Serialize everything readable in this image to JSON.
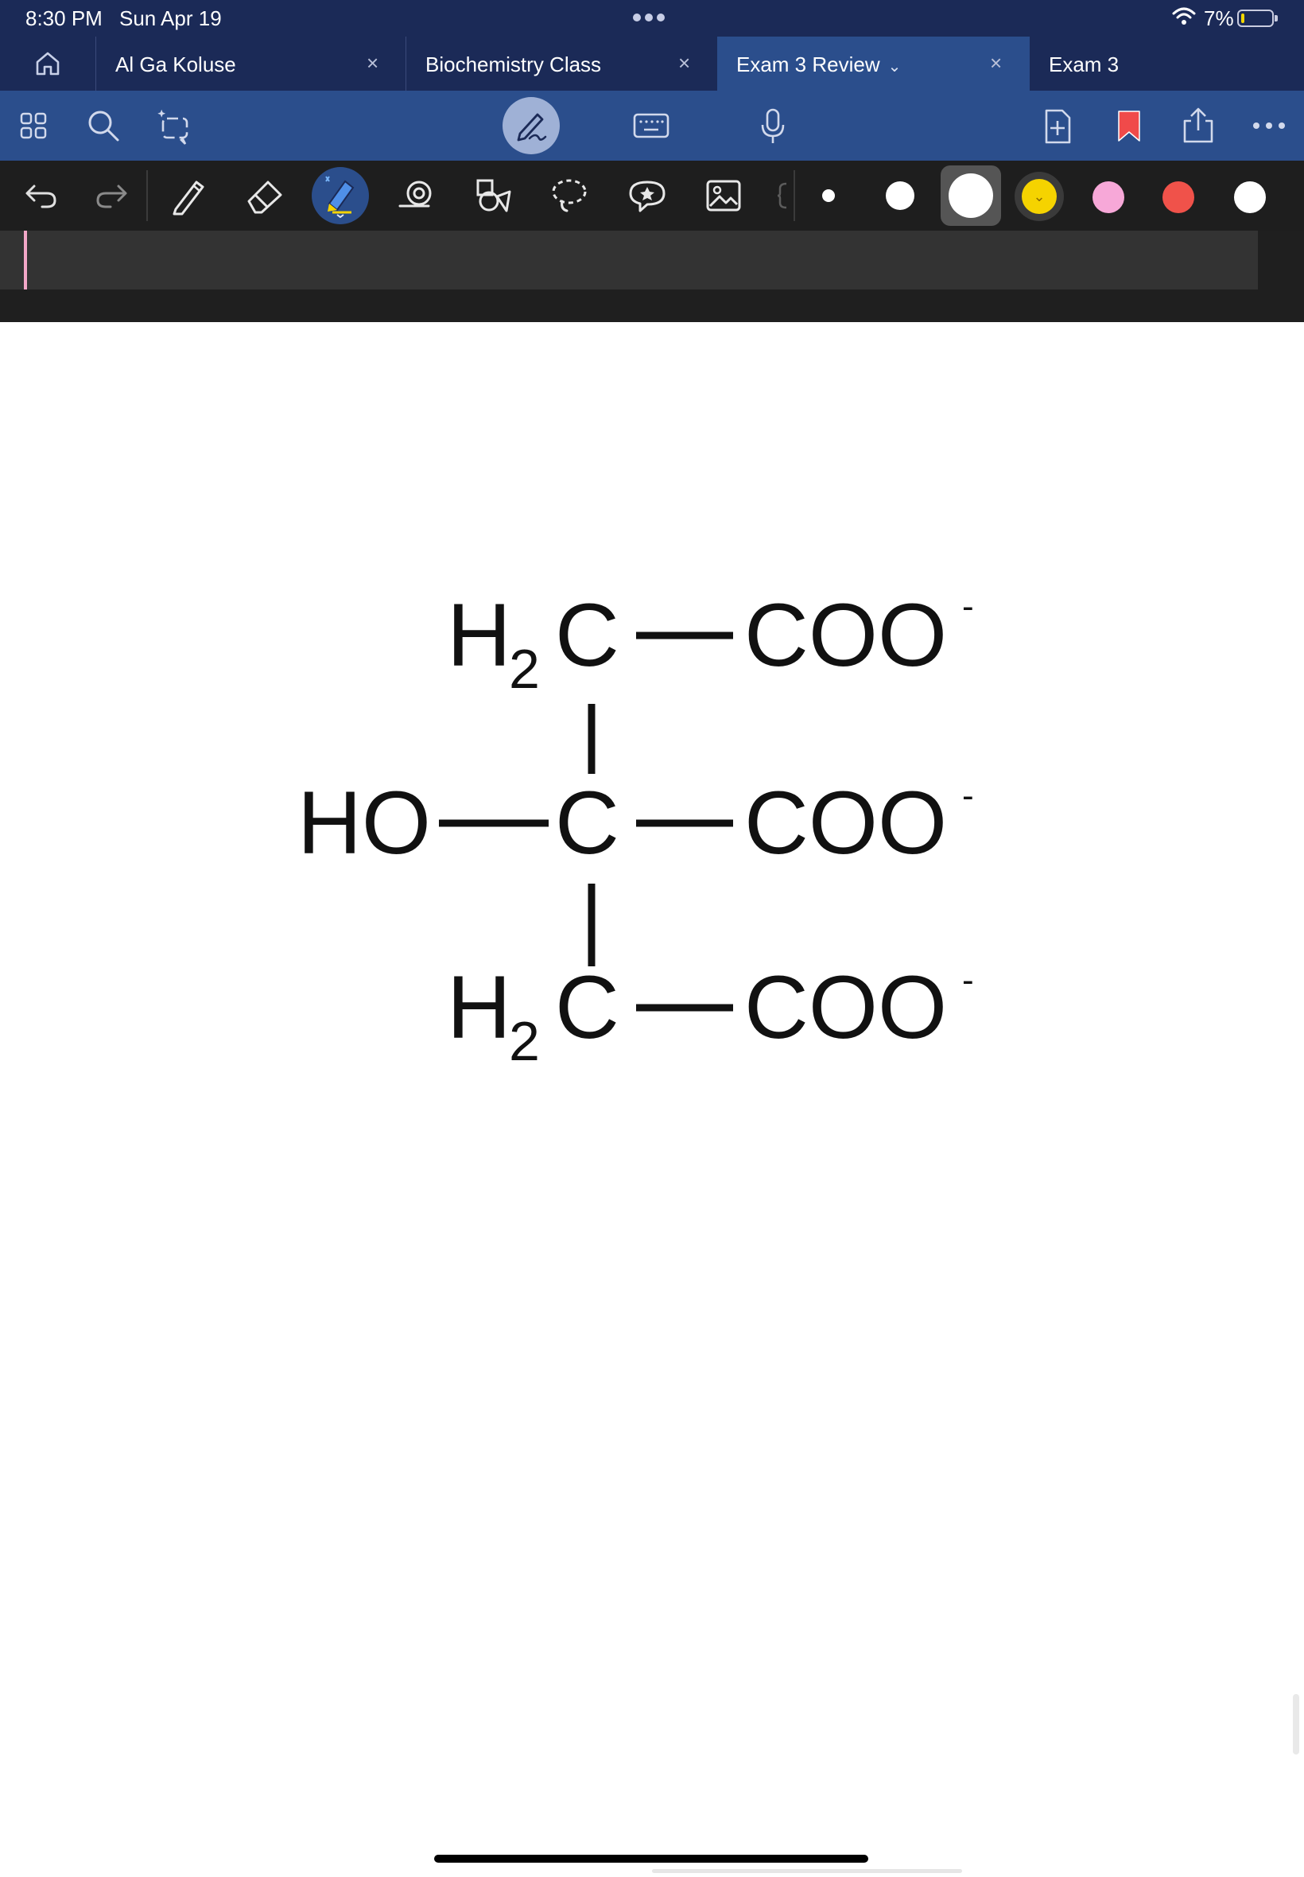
{
  "status_bar": {
    "time": "8:30 PM",
    "date": "Sun Apr 19",
    "battery_percent": "7%",
    "battery_level": 0.07
  },
  "tabs": [
    {
      "label": "Al Ga Koluse",
      "closable": true,
      "active": false
    },
    {
      "label": "Biochemistry Class",
      "closable": true,
      "active": false
    },
    {
      "label": "Exam 3 Review",
      "closable": true,
      "active": true,
      "dropdown": true
    },
    {
      "label": "Exam 3",
      "closable": false,
      "active": false
    }
  ],
  "toolbar_icons": [
    "grid-icon",
    "search-icon",
    "magic-select-icon",
    "pen-handwriting-icon",
    "keyboard-icon",
    "microphone-icon",
    "add-page-icon",
    "bookmark-icon",
    "share-icon",
    "more-icon"
  ],
  "drawing_tools": [
    "undo-icon",
    "redo-icon",
    "pen-icon",
    "eraser-icon",
    "highlighter-icon",
    "zoom-lasso-icon",
    "shapes-icon",
    "lasso-icon",
    "sticker-icon",
    "image-icon"
  ],
  "palette": {
    "sizes": [
      "small",
      "medium",
      "large"
    ],
    "colors": [
      "#f5d300",
      "#f7a8d8",
      "#f0524a",
      "#ffffff"
    ],
    "selected_size": "large"
  },
  "colors": {
    "status_bg": "#1b2a57",
    "active_tab": "#2b4e8c",
    "toolbar_bg": "#2b4e8c",
    "tools_bg": "#1e1e1e",
    "cursor": "#f3a7c8"
  },
  "structure": {
    "rows": [
      {
        "left": "H",
        "left_sub": "2",
        "left_after": "C",
        "right": "COO",
        "charge": "-"
      },
      {
        "prefix": "HO",
        "center": "C",
        "right": "COO",
        "charge": "-"
      },
      {
        "left": "H",
        "left_sub": "2",
        "left_after": "C",
        "right": "COO",
        "charge": "-"
      }
    ]
  }
}
